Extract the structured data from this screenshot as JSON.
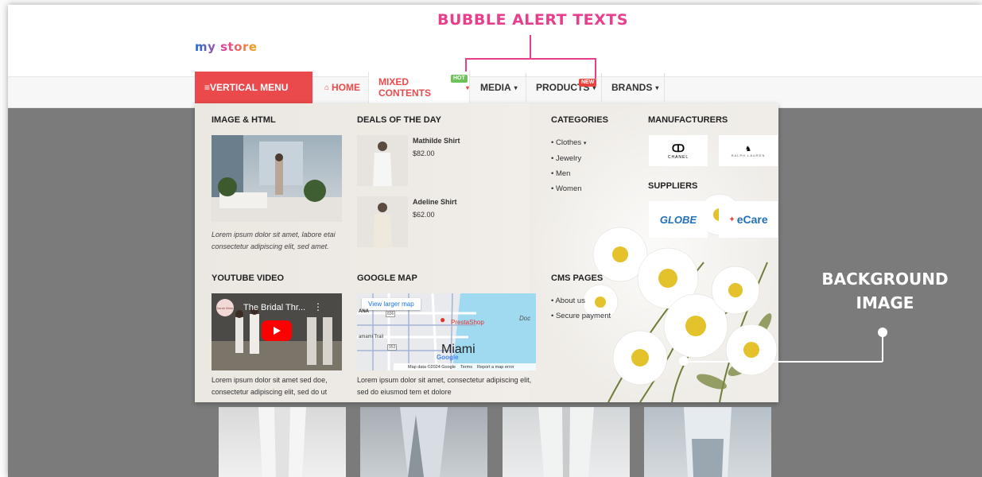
{
  "annotations": {
    "bubble_alert_texts": "BUBBLE ALERT TEXTS",
    "background_image_line1": "BACKGROUND",
    "background_image_line2": "IMAGE"
  },
  "store": {
    "logo_text": "my store"
  },
  "nav": {
    "vertical_menu": "≡VERTICAL MENU",
    "home": "HOME",
    "mixed_contents": "MIXED CONTENTS",
    "media": "MEDIA",
    "products": "PRODUCTS",
    "brands": "BRANDS",
    "hot_badge": "HOT",
    "new_badge": "NEW"
  },
  "mega_menu": {
    "image_html": {
      "title": "IMAGE & HTML",
      "caption": "Lorem ipsum dolor sit amet, labore etai consectetur adipiscing elit, sed amet."
    },
    "deals": {
      "title": "DEALS OF THE DAY",
      "items": [
        {
          "name": "Mathilde Shirt",
          "price": "$82.00"
        },
        {
          "name": "Adeline Shirt",
          "price": "$62.00"
        }
      ]
    },
    "categories": {
      "title": "CATEGORIES",
      "items": [
        "Clothes",
        "Jewelry",
        "Men",
        "Women"
      ]
    },
    "manufacturers": {
      "title": "MANUFACTURERS",
      "logos": [
        "CHANEL",
        "RALPH LAUREN"
      ]
    },
    "suppliers": {
      "title": "SUPPLIERS",
      "logos": [
        "GLOBE",
        "eCare"
      ]
    },
    "youtube": {
      "title": "YOUTUBE VIDEO",
      "video_title": "The Bridal Thr...",
      "channel": "Sarah Bride",
      "caption": "Lorem ipsum dolor sit amet sed doe, consectetur adipiscing elit, sed do ut"
    },
    "google_map": {
      "title": "GOOGLE MAP",
      "larger_map": "View larger map",
      "pin_label": "PrestaShop",
      "city": "Miami",
      "google": "Google",
      "footer_data": "Map data ©2024 Google",
      "footer_terms": "Terms",
      "footer_report": "Report a map error",
      "street_1": "ANA",
      "street_2": "amami Trail",
      "street_3": "Doc",
      "route": "953",
      "route_2": "836",
      "caption": "Lorem ipsum dolor sit amet, consectetur adipiscing elit, sed do eiusmod tem et dolore"
    },
    "cms_pages": {
      "title": "CMS PAGES",
      "items": [
        "About us",
        "Secure payment"
      ]
    }
  },
  "colors": {
    "accent_red": "#ea4a4c",
    "annotation_pink": "#e83e8c",
    "hot_badge": "#6ac259",
    "new_badge": "#e8443f"
  }
}
